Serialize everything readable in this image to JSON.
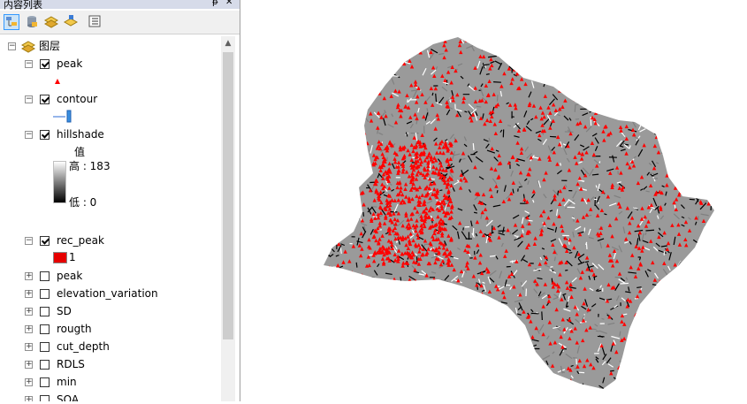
{
  "toc": {
    "title": "内容列表",
    "pin_glyph": "ᵽ",
    "close_glyph": "✕",
    "toolbar": [
      {
        "name": "list-by-drawing-order-button",
        "icon": "list-by-drawing-order-icon",
        "active": true
      },
      {
        "name": "list-by-source-button",
        "icon": "database-icon",
        "active": false
      },
      {
        "name": "list-by-visibility-button",
        "icon": "layers-visibility-icon",
        "active": false
      },
      {
        "name": "list-by-selection-button",
        "icon": "selection-layers-icon",
        "active": false
      },
      {
        "name": "options-button",
        "icon": "options-list-icon",
        "active": false
      }
    ],
    "root": {
      "label": "图层",
      "expanded": true
    },
    "legend_hillshade": {
      "header": "值",
      "high": "高 : 183",
      "low": "低 : 0"
    },
    "legend_rec_peak": {
      "value": "1",
      "color": "#e60000"
    },
    "layers": [
      {
        "label": "peak",
        "checked": true,
        "expanded": true
      },
      {
        "label": "contour",
        "checked": true,
        "expanded": true
      },
      {
        "label": "hillshade",
        "checked": true,
        "expanded": true
      },
      {
        "label": "rec_peak",
        "checked": true,
        "expanded": true
      },
      {
        "label": "peak",
        "checked": false,
        "expanded": false
      },
      {
        "label": "elevation_variation",
        "checked": false,
        "expanded": false
      },
      {
        "label": "SD",
        "checked": false,
        "expanded": false
      },
      {
        "label": "rougth",
        "checked": false,
        "expanded": false
      },
      {
        "label": "cut_depth",
        "checked": false,
        "expanded": false
      },
      {
        "label": "RDLS",
        "checked": false,
        "expanded": false
      },
      {
        "label": "min",
        "checked": false,
        "expanded": false
      },
      {
        "label": "SOA",
        "checked": false,
        "expanded": false
      }
    ]
  },
  "map": {
    "peak_color": "#ff0000",
    "hillshade_light": "#ffffff",
    "hillshade_dark": "#000000",
    "hillshade_mid": "#808080"
  }
}
